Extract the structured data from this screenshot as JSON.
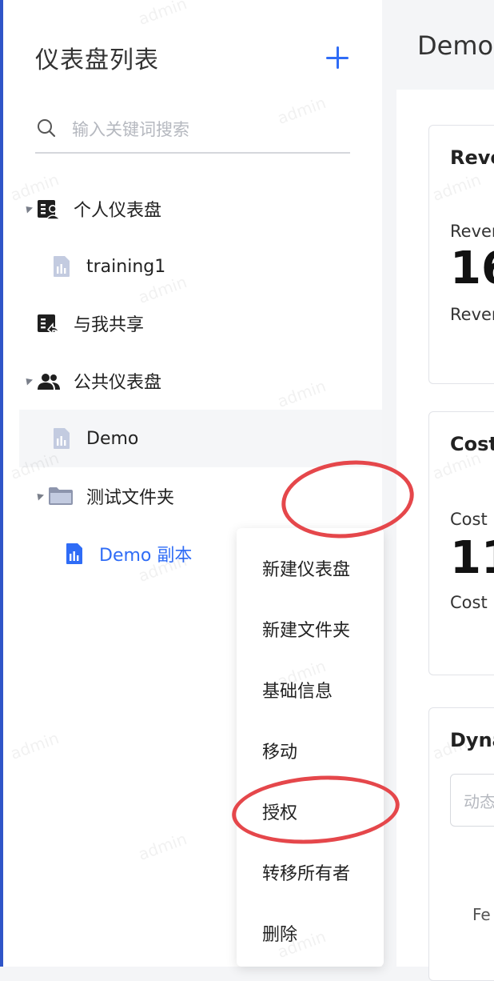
{
  "sidebar": {
    "title": "仪表盘列表",
    "search_placeholder": "输入关键词搜索",
    "items": [
      {
        "label": "个人仪表盘"
      },
      {
        "label": "training1"
      },
      {
        "label": "与我共享"
      },
      {
        "label": "公共仪表盘"
      },
      {
        "label": "Demo"
      },
      {
        "label": "测试文件夹"
      },
      {
        "label": "Demo 副本"
      }
    ]
  },
  "main": {
    "title": "Demo",
    "cards": [
      {
        "title": "Reve",
        "sub1": "Rever",
        "value": "16",
        "sub2": "Rever"
      },
      {
        "title": "Cost",
        "sub1": "Cost",
        "value": "11",
        "sub2": "Cost"
      },
      {
        "title": "Dyna",
        "filter_placeholder": "动态",
        "axis_label": "Fe"
      }
    ]
  },
  "context_menu": {
    "items": [
      "新建仪表盘",
      "新建文件夹",
      "基础信息",
      "移动",
      "授权",
      "转移所有者",
      "删除"
    ]
  },
  "watermark": "admin",
  "colors": {
    "accent": "#2f6cf6",
    "annotation": "#e5474b"
  }
}
